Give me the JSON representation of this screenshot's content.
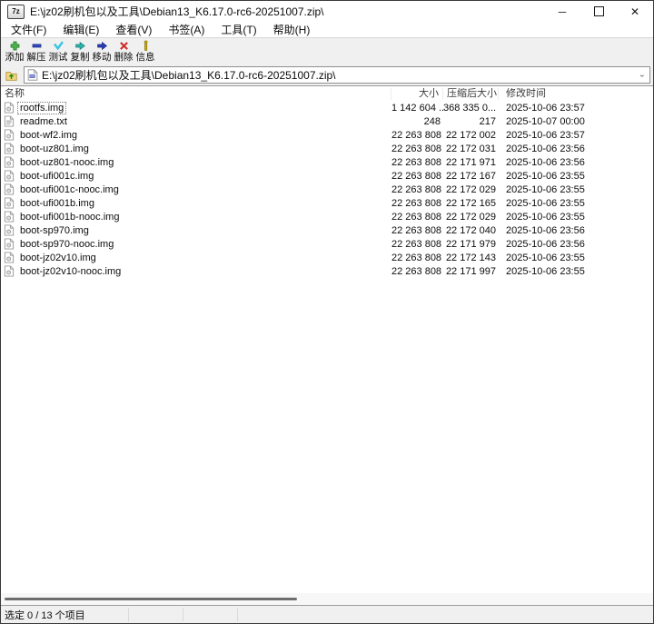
{
  "window": {
    "app_icon_label": "7z",
    "title": "E:\\jz02刷机包以及工具\\Debian13_K6.17.0-rc6-20251007.zip\\",
    "controls": {
      "minimize": "─",
      "maximize": "□",
      "close": "✕"
    }
  },
  "menu": {
    "items": [
      {
        "id": "file",
        "label": "文件(F)"
      },
      {
        "id": "edit",
        "label": "编辑(E)"
      },
      {
        "id": "view",
        "label": "查看(V)"
      },
      {
        "id": "bookmarks",
        "label": "书签(A)"
      },
      {
        "id": "tools",
        "label": "工具(T)"
      },
      {
        "id": "help",
        "label": "帮助(H)"
      }
    ]
  },
  "toolbar": {
    "buttons": [
      {
        "id": "add",
        "label": "添加",
        "icon": "add-plus-icon",
        "color": "#4db34d"
      },
      {
        "id": "extract",
        "label": "解压",
        "icon": "extract-minus-icon",
        "color": "#3347c2"
      },
      {
        "id": "test",
        "label": "测试",
        "icon": "test-check-icon",
        "color": "#37c4e0"
      },
      {
        "id": "copy",
        "label": "复制",
        "icon": "copy-arrow-icon",
        "color": "#2ab5ad"
      },
      {
        "id": "move",
        "label": "移动",
        "icon": "move-arrow-icon",
        "color": "#2b3fbd"
      },
      {
        "id": "delete",
        "label": "删除",
        "icon": "delete-x-icon",
        "color": "#d22b2b"
      },
      {
        "id": "info",
        "label": "信息",
        "icon": "info-icon",
        "color": "#d8b400"
      }
    ]
  },
  "address": {
    "path": "E:\\jz02刷机包以及工具\\Debian13_K6.17.0-rc6-20251007.zip\\"
  },
  "list": {
    "columns": [
      {
        "id": "name",
        "label": "名称",
        "align": "left"
      },
      {
        "id": "size",
        "label": "大小",
        "align": "right"
      },
      {
        "id": "packed",
        "label": "压缩后大小",
        "align": "right"
      },
      {
        "id": "modified",
        "label": "修改时间",
        "align": "left"
      }
    ],
    "files": [
      {
        "name": "rootfs.img",
        "type": "img",
        "size": "1 142 604 ...",
        "packed": "368 335 0...",
        "modified": "2025-10-06 23:57",
        "focused": true
      },
      {
        "name": "readme.txt",
        "type": "txt",
        "size": "248",
        "packed": "217",
        "modified": "2025-10-07 00:00",
        "focused": false
      },
      {
        "name": "boot-wf2.img",
        "type": "img",
        "size": "22 263 808",
        "packed": "22 172 002",
        "modified": "2025-10-06 23:57",
        "focused": false
      },
      {
        "name": "boot-uz801.img",
        "type": "img",
        "size": "22 263 808",
        "packed": "22 172 031",
        "modified": "2025-10-06 23:56",
        "focused": false
      },
      {
        "name": "boot-uz801-nooc.img",
        "type": "img",
        "size": "22 263 808",
        "packed": "22 171 971",
        "modified": "2025-10-06 23:56",
        "focused": false
      },
      {
        "name": "boot-ufi001c.img",
        "type": "img",
        "size": "22 263 808",
        "packed": "22 172 167",
        "modified": "2025-10-06 23:55",
        "focused": false
      },
      {
        "name": "boot-ufi001c-nooc.img",
        "type": "img",
        "size": "22 263 808",
        "packed": "22 172 029",
        "modified": "2025-10-06 23:55",
        "focused": false
      },
      {
        "name": "boot-ufi001b.img",
        "type": "img",
        "size": "22 263 808",
        "packed": "22 172 165",
        "modified": "2025-10-06 23:55",
        "focused": false
      },
      {
        "name": "boot-ufi001b-nooc.img",
        "type": "img",
        "size": "22 263 808",
        "packed": "22 172 029",
        "modified": "2025-10-06 23:55",
        "focused": false
      },
      {
        "name": "boot-sp970.img",
        "type": "img",
        "size": "22 263 808",
        "packed": "22 172 040",
        "modified": "2025-10-06 23:56",
        "focused": false
      },
      {
        "name": "boot-sp970-nooc.img",
        "type": "img",
        "size": "22 263 808",
        "packed": "22 171 979",
        "modified": "2025-10-06 23:56",
        "focused": false
      },
      {
        "name": "boot-jz02v10.img",
        "type": "img",
        "size": "22 263 808",
        "packed": "22 172 143",
        "modified": "2025-10-06 23:55",
        "focused": false
      },
      {
        "name": "boot-jz02v10-nooc.img",
        "type": "img",
        "size": "22 263 808",
        "packed": "22 171 997",
        "modified": "2025-10-06 23:55",
        "focused": false
      }
    ]
  },
  "statusbar": {
    "selection": "选定 0 / 13 个项目"
  }
}
